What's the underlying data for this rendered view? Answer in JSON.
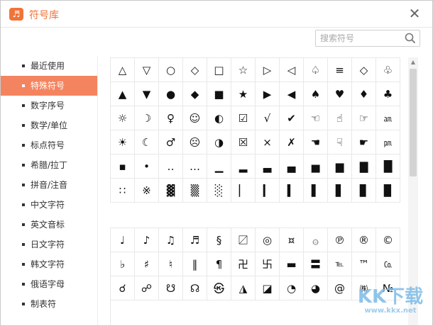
{
  "window": {
    "title": "符号库",
    "icon_glyph": "♬"
  },
  "search": {
    "placeholder": "搜索符号"
  },
  "sidebar": {
    "items": [
      {
        "label": "最近使用"
      },
      {
        "label": "特殊符号"
      },
      {
        "label": "数字序号"
      },
      {
        "label": "数学/单位"
      },
      {
        "label": "标点符号"
      },
      {
        "label": "希腊/拉丁"
      },
      {
        "label": "拼音/注音"
      },
      {
        "label": "中文字符"
      },
      {
        "label": "英文音标"
      },
      {
        "label": "日文字符"
      },
      {
        "label": "韩文字符"
      },
      {
        "label": "俄语字母"
      },
      {
        "label": "制表符"
      }
    ],
    "active_index": 1
  },
  "panel1": {
    "rows": [
      [
        "△",
        "▽",
        "○",
        "◇",
        "□",
        "☆",
        "▷",
        "◁",
        "♤",
        "≡",
        "◇",
        "♧"
      ],
      [
        "▲",
        "▼",
        "●",
        "◆",
        "■",
        "★",
        "▶",
        "◀",
        "♠",
        "♥",
        "♦",
        "♣"
      ],
      [
        "☼",
        "☽",
        "♀",
        "☺",
        "◐",
        "☑",
        "√",
        "✔",
        "☜",
        "☝",
        "☞",
        "㏂"
      ],
      [
        "☀",
        "☾",
        "♂",
        "☹",
        "◑",
        "☒",
        "×",
        "✗",
        "☚",
        "☟",
        "☛",
        "㏘"
      ],
      [
        "▪",
        "•",
        "‥",
        "…",
        "▁",
        "▂",
        "▃",
        "▄",
        "▅",
        "▆",
        "▇",
        "█"
      ],
      [
        "∷",
        "※",
        "▓",
        "▒",
        "░",
        "▏",
        "▎",
        "▍",
        "▌",
        "▋",
        "▊",
        "▉"
      ]
    ]
  },
  "panel2": {
    "rows": [
      [
        "♩",
        "♪",
        "♫",
        "♬",
        "§",
        "〼",
        "◎",
        "¤",
        "۞",
        "℗",
        "®",
        "©"
      ],
      [
        "♭",
        "♯",
        "♮",
        "‖",
        "¶",
        "卍",
        "卐",
        "▬",
        "〓",
        "℡",
        "™",
        "㏇"
      ],
      [
        "☌",
        "☍",
        "☋",
        "☊",
        "㉿",
        "◮",
        "◪",
        "◔",
        "◕",
        "@",
        "㈱",
        "№"
      ]
    ]
  },
  "watermark": {
    "main": "KK下载",
    "sub": "www.kkx.net"
  }
}
